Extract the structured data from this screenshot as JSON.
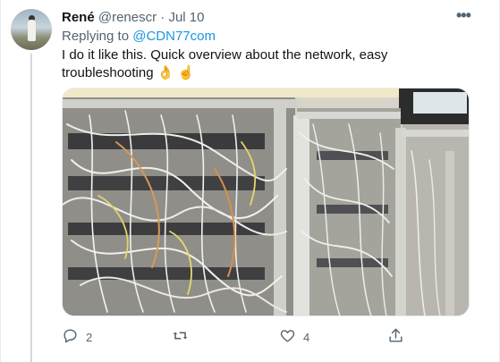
{
  "tweet": {
    "author_name": "René",
    "author_handle": "@renescr",
    "separator": "·",
    "date": "Jul 10",
    "replying_prefix": "Replying to",
    "replying_handle": "@CDN77com",
    "text": "I do it like this. Quick overview about the network, easy troubleshooting 👌 ☝️",
    "media_description": "photo"
  },
  "actions": {
    "reply_count": "2",
    "retweet_count": "",
    "like_count": "4"
  },
  "colors": {
    "text_primary": "#0f1419",
    "text_secondary": "#536471",
    "link": "#1b95e0",
    "border": "#e6ecf0"
  }
}
